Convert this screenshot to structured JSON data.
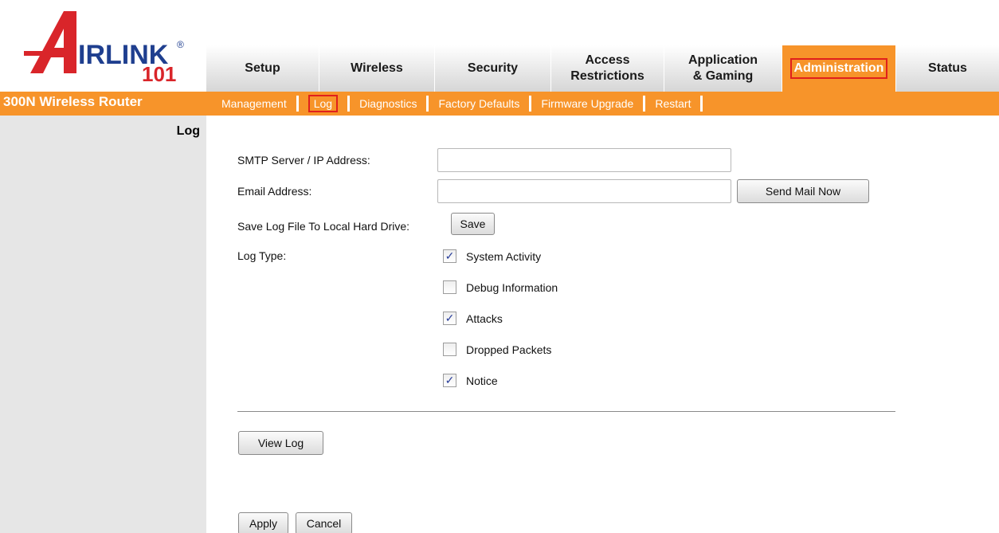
{
  "brand": {
    "logo_letter": "A",
    "logo_word": "IRLINK",
    "logo_number": "101",
    "logo_mark": "®",
    "product_name": "300N Wireless Router"
  },
  "tabs": [
    {
      "label": "Setup"
    },
    {
      "label": "Wireless"
    },
    {
      "label": "Security"
    },
    {
      "label": "Access Restrictions"
    },
    {
      "label": "Application & Gaming"
    },
    {
      "label": "Administration",
      "active": true
    },
    {
      "label": "Status"
    }
  ],
  "subnav": [
    {
      "label": "Management"
    },
    {
      "label": "Log",
      "active": true
    },
    {
      "label": "Diagnostics"
    },
    {
      "label": "Factory Defaults"
    },
    {
      "label": "Firmware Upgrade"
    },
    {
      "label": "Restart"
    }
  ],
  "section_title": "Log",
  "form": {
    "smtp_label": "SMTP Server / IP Address:",
    "smtp_value": "",
    "email_label": "Email Address:",
    "email_value": "",
    "send_mail_label": "Send Mail Now",
    "save_log_label": "Save Log File To Local Hard Drive:",
    "save_button": "Save",
    "log_type_label": "Log Type:",
    "log_types": [
      {
        "label": "System Activity",
        "checked": true
      },
      {
        "label": "Debug Information",
        "checked": false
      },
      {
        "label": "Attacks",
        "checked": true
      },
      {
        "label": "Dropped Packets",
        "checked": false
      },
      {
        "label": "Notice",
        "checked": true
      }
    ],
    "view_log_button": "View Log",
    "apply_button": "Apply",
    "cancel_button": "Cancel"
  },
  "colors": {
    "accent_orange": "#f7942a",
    "highlight_red": "#e0201c",
    "logo_blue": "#1f3f8f",
    "logo_red": "#d9252a"
  }
}
